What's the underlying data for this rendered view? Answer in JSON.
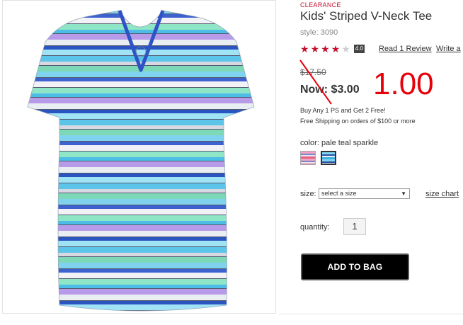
{
  "product": {
    "badge": "CLEARANCE",
    "title": "Kids' Striped V-Neck Tee",
    "style": "style: 3090",
    "rating_value": 4,
    "rating_badge": "4.0",
    "read_review": "Read 1 Review",
    "write_review": "Write a",
    "old_price": "$17.50",
    "now_price": "Now: $3.00",
    "handwritten_price": "1.00",
    "promo": "Buy Any 1 PS and Get 2 Free!",
    "shipping": "Free Shipping on orders of $100 or more",
    "color_label": "color: pale teal sparkle",
    "swatches": [
      "pink stripe",
      "pale teal sparkle"
    ],
    "size_label": "size:",
    "size_placeholder": "select a size",
    "size_chart": "size chart",
    "quantity_label": "quantity:",
    "quantity_value": "1",
    "add_to_bag": "ADD TO BAG"
  },
  "colors": {
    "accent": "#c4122f",
    "annotation": "#e8000b",
    "button": "#000000"
  }
}
